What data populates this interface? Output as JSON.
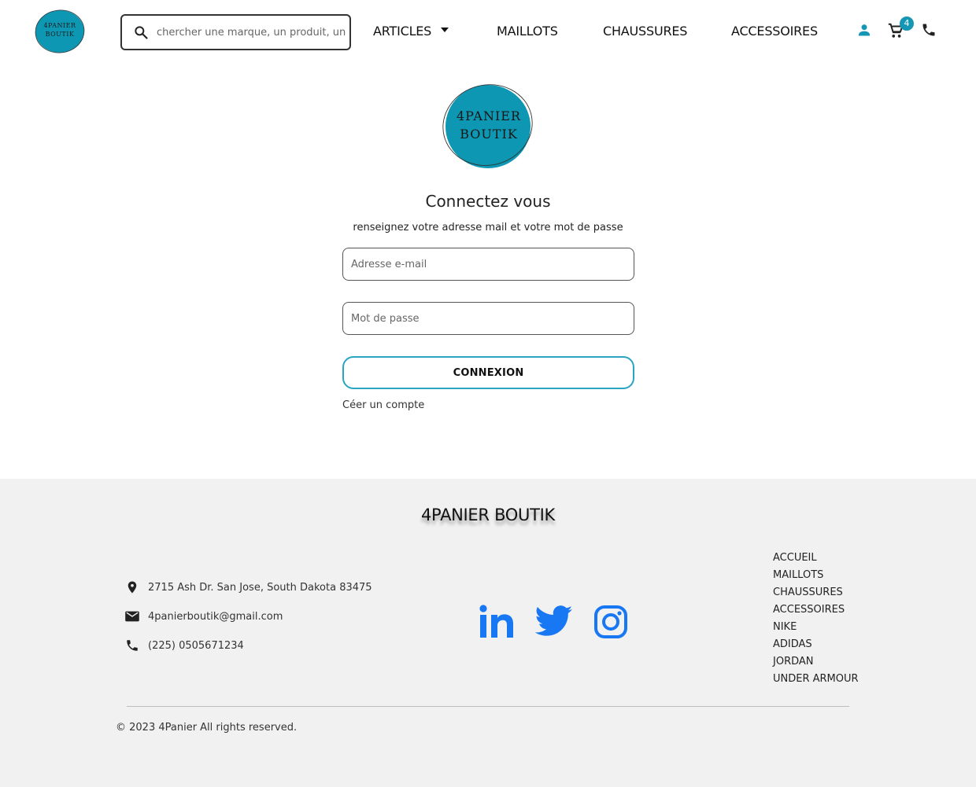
{
  "brand": {
    "logo_line1": "4PANIER",
    "logo_line2": "BOUTIK",
    "accent_color": "#0d97b3"
  },
  "header": {
    "search_placeholder": "chercher une marque, un produit, une catégorie",
    "nav": {
      "articles": "ARTICLES",
      "maillots": "MAILLOTS",
      "chaussures": "CHAUSSURES",
      "accessoires": "ACCESSOIRES"
    },
    "icons": [
      "user-icon",
      "cart-icon",
      "phone-icon"
    ],
    "cart_count": "4"
  },
  "login": {
    "title": "Connectez vous",
    "subtitle": "renseignez votre adresse mail et votre mot de passe",
    "email_placeholder": "Adresse e-mail",
    "password_placeholder": "Mot de passe",
    "submit_label": "CONNEXION",
    "create_account": "Céer un compte"
  },
  "footer": {
    "title": "4PANIER BOUTIK",
    "address": "2715 Ash Dr. San Jose, South Dakota 83475",
    "email": "4panierboutik@gmail.com",
    "phone": "(225) 0505671234",
    "social": [
      "linkedin-icon",
      "twitter-icon",
      "instagram-icon"
    ],
    "social_color": "#1877f2",
    "links": [
      "ACCUEIL",
      "MAILLOTS",
      "CHAUSSURES",
      "ACCESSOIRES",
      "NIKE",
      "ADIDAS",
      "JORDAN",
      "UNDER ARMOUR"
    ],
    "copyright": "© 2023 4Panier All rights reserved."
  }
}
